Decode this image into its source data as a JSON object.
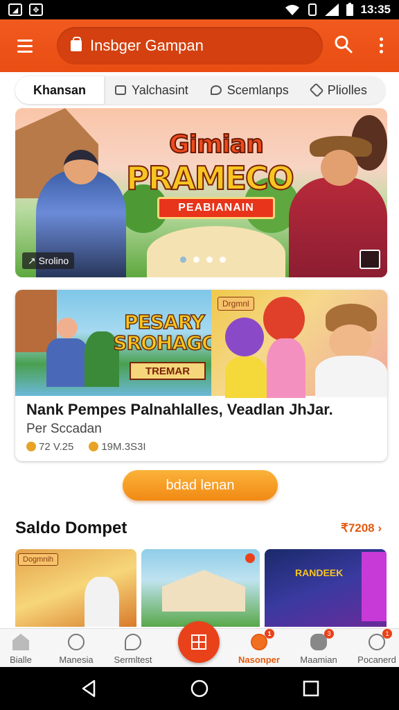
{
  "status": {
    "time": "13:35"
  },
  "header": {
    "search_text": "Insbger Gampan"
  },
  "tabs": [
    {
      "label": "Khansan"
    },
    {
      "label": "Yalchasint"
    },
    {
      "label": "Scemlanps"
    },
    {
      "label": "Pliolles"
    }
  ],
  "hero": {
    "logo_line1": "Gimian",
    "logo_line2": "PRAMECO",
    "ribbon": "PEABIANAIN",
    "badge": "Srolino",
    "dot_count": 4,
    "active_dot": 0
  },
  "card": {
    "art_title": "PESARY SROHAGC",
    "art_sub": "TREMAR",
    "art_tag": "Drgmnl",
    "title": "Nank Pempes Palnahlalles, Veadlan JhJar.",
    "subtitle": "Per Sccadan",
    "stat1": "72 V.25",
    "stat2": "19M.3S3I"
  },
  "cta": {
    "label": "bdad lenan"
  },
  "section": {
    "title": "Saldo Dompet",
    "link": "₹7208"
  },
  "thumbs": [
    {
      "label": "Dogmnih"
    },
    {
      "label": ""
    },
    {
      "label": "RANDEEK"
    }
  ],
  "bottom_nav": [
    {
      "label": "Bialle",
      "badge": ""
    },
    {
      "label": "Manesia",
      "badge": ""
    },
    {
      "label": "Sermltest",
      "badge": ""
    },
    {
      "label": "Nasonper",
      "badge": "1"
    },
    {
      "label": "Maamian",
      "badge": "3"
    },
    {
      "label": "Pocanerd",
      "badge": "1"
    }
  ],
  "colors": {
    "brand": "#f15a1f",
    "accent": "#f18a14"
  }
}
